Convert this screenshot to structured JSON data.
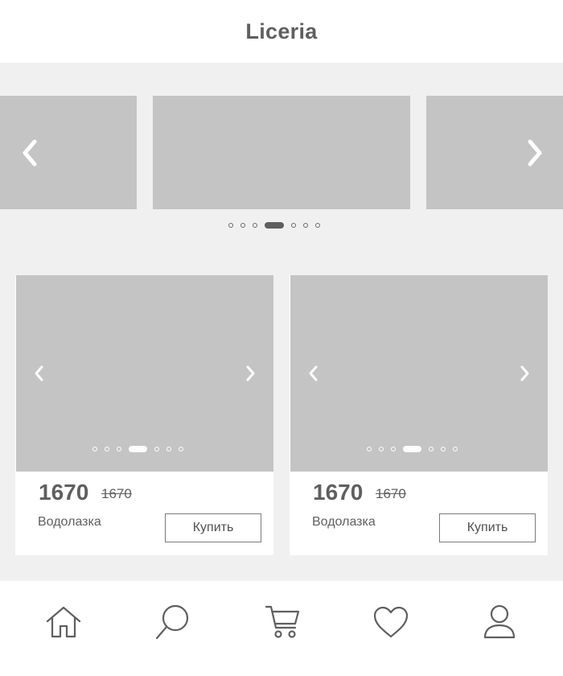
{
  "header": {
    "title": "Liceria"
  },
  "banner_carousel": {
    "slide_count": 7,
    "active_index": 3,
    "icons": {
      "prev": "chevron-left-icon",
      "next": "chevron-right-icon"
    }
  },
  "products": [
    {
      "price": "1670",
      "old_price": "1670",
      "name": "Водолазка",
      "buy_label": "Купить",
      "image_count": 7,
      "active_image_index": 3
    },
    {
      "price": "1670",
      "old_price": "1670",
      "name": "Водолазка",
      "buy_label": "Купить",
      "image_count": 7,
      "active_image_index": 3
    }
  ],
  "bottom_nav": {
    "items": [
      {
        "icon": "home-icon"
      },
      {
        "icon": "search-icon"
      },
      {
        "icon": "cart-icon"
      },
      {
        "icon": "heart-icon"
      },
      {
        "icon": "user-icon"
      }
    ]
  },
  "colors": {
    "background": "#f0f0f0",
    "placeholder": "#c4c4c4",
    "text": "#5f5f5f",
    "surface": "#ffffff"
  }
}
